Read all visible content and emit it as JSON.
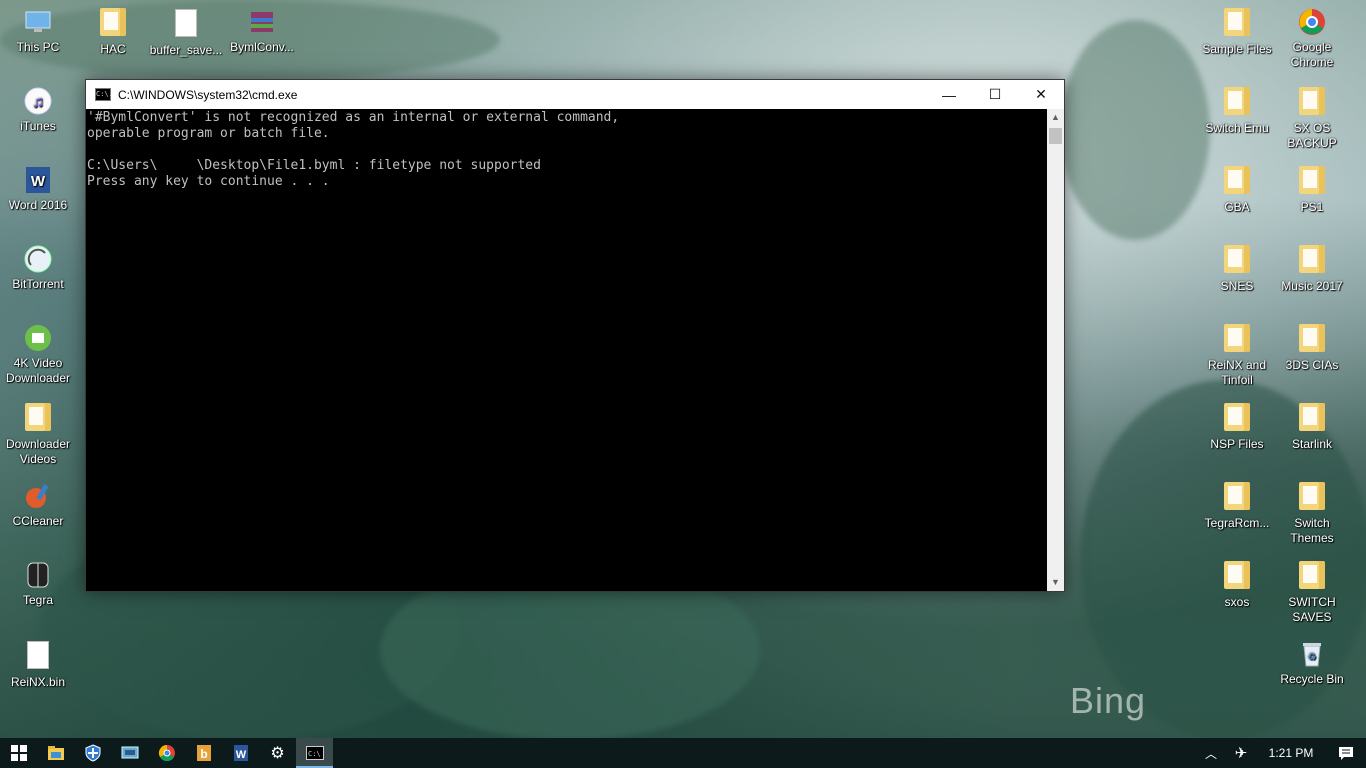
{
  "desktop": {
    "left_icons": [
      {
        "label": "This PC",
        "icon": "this-pc-icon"
      },
      {
        "label": "iTunes",
        "icon": "itunes-icon"
      },
      {
        "label": "Word 2016",
        "icon": "word-icon"
      },
      {
        "label": "BitTorrent",
        "icon": "bittorrent-icon"
      },
      {
        "label": "4K Video Downloader",
        "icon": "4k-video-downloader-icon"
      },
      {
        "label": "Downloader Videos",
        "icon": "folder-icon"
      },
      {
        "label": "CCleaner",
        "icon": "ccleaner-icon"
      },
      {
        "label": "Tegra",
        "icon": "nintendo-switch-icon"
      },
      {
        "label": "ReiNX.bin",
        "icon": "file-icon"
      }
    ],
    "top_icons": [
      {
        "label": "HAC",
        "icon": "folder-icon"
      },
      {
        "label": "buffer_save...",
        "icon": "file-icon"
      },
      {
        "label": "BymlConv...",
        "icon": "winrar-archive-icon"
      }
    ],
    "right_icons": [
      {
        "label": "Sample Files",
        "icon": "folder-icon"
      },
      {
        "label": "Google Chrome",
        "icon": "chrome-icon"
      },
      {
        "label": "Switch Emu",
        "icon": "folder-icon"
      },
      {
        "label": "SX OS BACKUP",
        "icon": "folder-icon"
      },
      {
        "label": "GBA",
        "icon": "folder-icon"
      },
      {
        "label": "PS1",
        "icon": "folder-icon"
      },
      {
        "label": "SNES",
        "icon": "folder-icon"
      },
      {
        "label": "Music 2017",
        "icon": "folder-icon"
      },
      {
        "label": "ReiNX and Tinfoil",
        "icon": "folder-icon"
      },
      {
        "label": "3DS CIAs",
        "icon": "folder-icon"
      },
      {
        "label": "NSP Files",
        "icon": "folder-icon"
      },
      {
        "label": "Starlink",
        "icon": "folder-icon"
      },
      {
        "label": "TegraRcm...",
        "icon": "folder-icon"
      },
      {
        "label": "Switch Themes",
        "icon": "folder-icon"
      },
      {
        "label": "sxos",
        "icon": "folder-icon"
      },
      {
        "label": "SWITCH SAVES",
        "icon": "folder-icon"
      },
      {
        "label": "Recycle Bin",
        "icon": "recycle-bin-icon"
      }
    ],
    "watermark": "Bing"
  },
  "cmd_window": {
    "title": "C:\\WINDOWS\\system32\\cmd.exe",
    "icon_text": "C:\\.",
    "minimize": "—",
    "maximize": "☐",
    "close": "✕",
    "output": "'#BymlConvert' is not recognized as an internal or external command,\noperable program or batch file.\n\nC:\\Users\\     \\Desktop\\File1.byml : filetype not supported\nPress any key to continue . . ."
  },
  "taskbar": {
    "time": "1:21 PM",
    "apps": [
      "start-icon",
      "file-explorer-icon",
      "windows-defender-icon",
      "control-panel-icon",
      "chrome-icon",
      "bing-icon",
      "word-icon",
      "settings-icon",
      "cmd-icon"
    ],
    "tray": [
      "chevron-up-icon",
      "airplane-mode-icon",
      "action-center-icon"
    ]
  }
}
